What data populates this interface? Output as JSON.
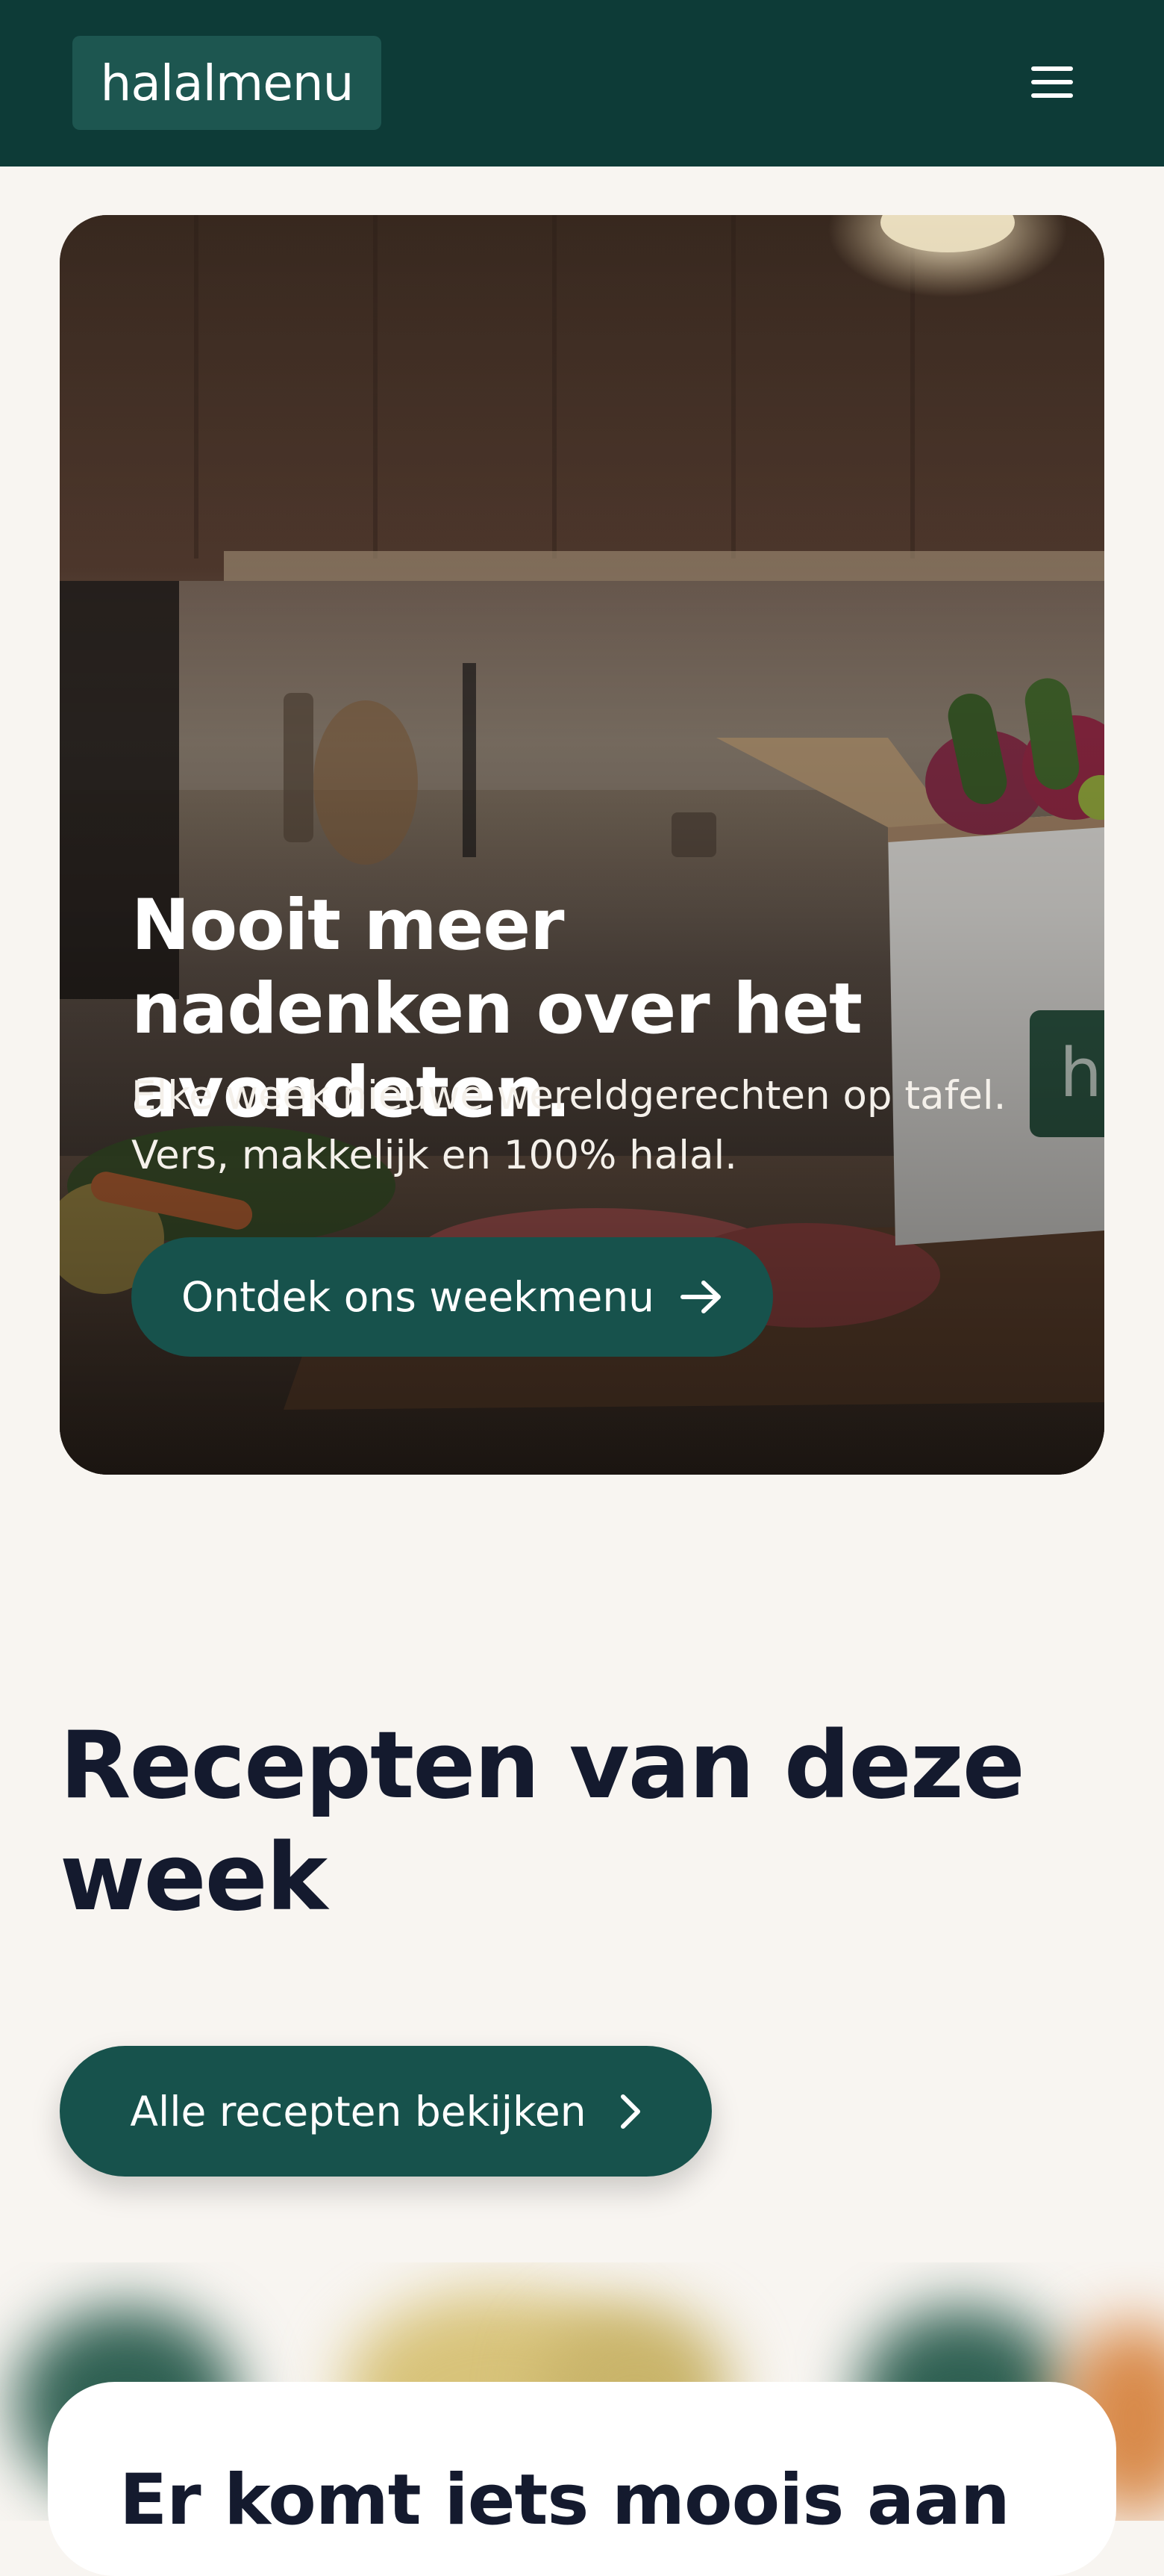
{
  "header": {
    "logo_text": "halalmenu",
    "menu_icon": "hamburger-menu-icon",
    "background": "#0d3b37"
  },
  "hero": {
    "title": "Nooit meer nadenken over het avondeten.",
    "subtitle": "Elke week nieuwe wereldgerechten op tafel. Vers, makkelijk en 100% halal.",
    "cta_label": "Ontdek ons weekmenu",
    "cta_icon": "arrow-right-icon"
  },
  "recipes": {
    "title": "Recepten van deze week",
    "button_label": "Alle recepten bekijken",
    "button_icon": "chevron-right-icon"
  },
  "card": {
    "title": "Er komt iets moois aan"
  },
  "colors": {
    "brand_dark": "#0d3b37",
    "brand": "#17524c",
    "page_bg": "#f8f5f1",
    "heading": "#141a2e"
  }
}
